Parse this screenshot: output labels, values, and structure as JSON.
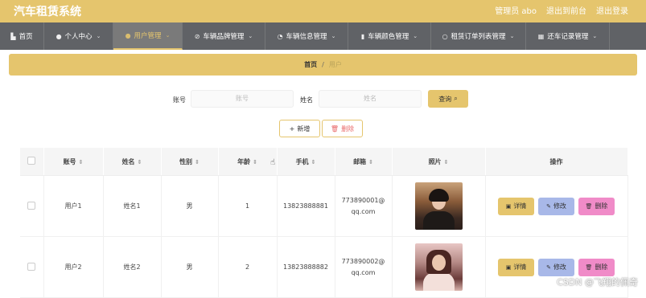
{
  "header": {
    "app_title": "汽车租赁系统",
    "admin_label": "管理员 abo",
    "to_front": "退出到前台",
    "logout": "退出登录"
  },
  "nav": [
    {
      "label": "首页",
      "icon": "home-icon"
    },
    {
      "label": "个人中心",
      "icon": "user-icon"
    },
    {
      "label": "用户管理",
      "icon": "user-icon"
    },
    {
      "label": "车辆品牌管理",
      "icon": "brand-icon"
    },
    {
      "label": "车辆信息管理",
      "icon": "gauge-icon"
    },
    {
      "label": "车辆颜色管理",
      "icon": "bar-chart-icon"
    },
    {
      "label": "租赁订单列表管理",
      "icon": "clock-icon"
    },
    {
      "label": "还车记录管理",
      "icon": "grid-icon"
    }
  ],
  "breadcrumb": {
    "home": "首页",
    "separator": "/",
    "current": "用户"
  },
  "search": {
    "account_label": "账号",
    "account_placeholder": "账号",
    "name_label": "姓名",
    "name_placeholder": "姓名",
    "query_button": "查询"
  },
  "actions": {
    "add": "新增",
    "delete": "删除"
  },
  "table": {
    "columns": [
      "账号",
      "姓名",
      "性别",
      "年龄",
      "手机",
      "邮箱",
      "照片",
      "操作"
    ],
    "rows": [
      {
        "account": "用户1",
        "name": "姓名1",
        "gender": "男",
        "age": "1",
        "phone": "13823888881",
        "email": "773890001@qq.com"
      },
      {
        "account": "用户2",
        "name": "姓名2",
        "gender": "男",
        "age": "2",
        "phone": "13823888882",
        "email": "773890002@qq.com"
      }
    ],
    "ops": {
      "detail": "详情",
      "edit": "修改",
      "remove": "删除"
    }
  },
  "watermark": "CSDN @飞翔的佩奇",
  "colors": {
    "accent": "#e5c56d",
    "nav_bg": "#606266",
    "edit_btn": "#a8b8e8",
    "delete_btn": "#f08bc8",
    "delete_text": "#e96a6a"
  }
}
